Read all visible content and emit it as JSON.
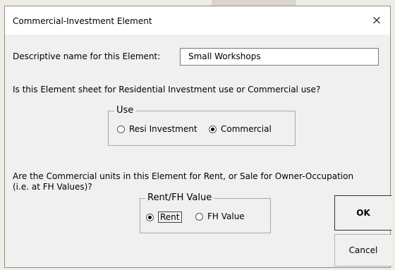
{
  "dialog": {
    "title": "Commercial-Investment Element",
    "close_glyph": "×",
    "name_label": "Descriptive name for this Element:",
    "name_value": "Small Workshops",
    "use_question": "Is this Element sheet for Residential Investment use or Commercial use?",
    "use_group": {
      "legend": "Use",
      "options": [
        "Resi Investment",
        "Commercial"
      ],
      "selected": "Commercial"
    },
    "rent_question_line1": "Are the Commercial units in this Element for Rent, or Sale for Owner-Occupation",
    "rent_question_line2": "(i.e. at FH Values)?",
    "rent_group": {
      "legend": "Rent/FH Value",
      "options": [
        "Rent",
        "FH Value"
      ],
      "selected": "Rent"
    },
    "ok_label": "OK",
    "cancel_label": "Cancel"
  }
}
